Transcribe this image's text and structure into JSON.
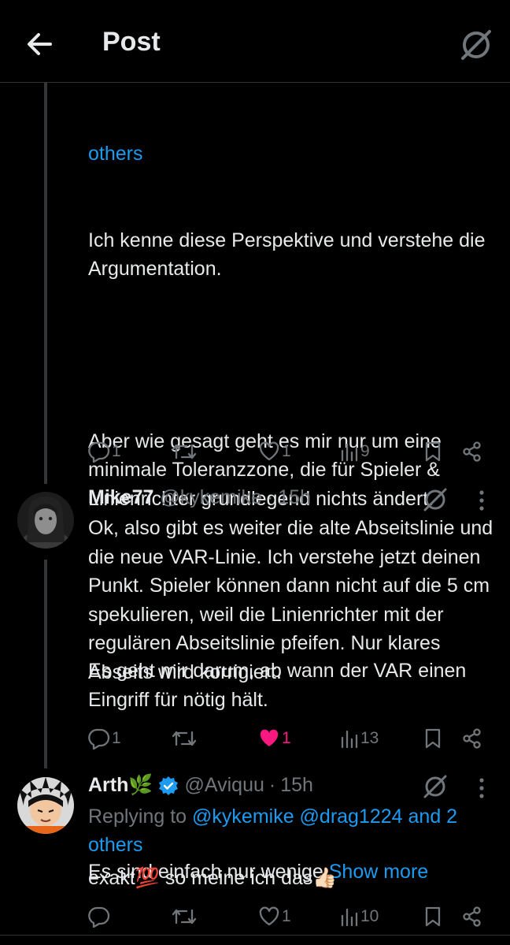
{
  "header": {
    "title": "Post",
    "back_icon": "arrow-left-icon",
    "grok_icon": "grok-icon"
  },
  "post1": {
    "continued_link": "others",
    "body_1": "Ich kenne diese Perspektive und verstehe die Argumentation.",
    "body_2": "Aber wie gesagt geht es mir nur um eine minimale Toleranzzone, die für Spieler & Linienrichter grundlegend nichts ändert.",
    "body_3": "Es geht mir darum, ab wann der VAR einen Eingriff für nötig hält.",
    "body_4": "Es sind einfach nur wenige ",
    "show_more": "Show more",
    "replies": "1",
    "likes": "1",
    "views": "9"
  },
  "post2": {
    "name": "Mike77",
    "handle": "@kykemike",
    "separator": "·",
    "time": "15h",
    "body": "Ok, also gibt es weiter die alte Abseitslinie und die neue VAR-Linie. Ich verstehe jetzt deinen Punkt. Spieler können dann nicht auf die 5 cm spekulieren, weil die Linienrichter mit der regulären Abseitslinie pfeifen. Nur klares Abseits wird korrigiert.",
    "replies": "1",
    "likes": "1",
    "views": "13",
    "liked_color": "#f91880"
  },
  "post3": {
    "name": "Arth🌿",
    "handle": "@Aviquu",
    "separator": "·",
    "time": "15h",
    "replying_prefix": "Replying to ",
    "replying_users": "@kykemike @drag1224 and 2",
    "replying_others": "others",
    "body": "exakt💯 so meine ich das👍🏻",
    "likes": "1",
    "views": "10"
  },
  "colors": {
    "accent": "#1d9bf0",
    "muted": "#71767b",
    "verified": "#1d9bf0"
  }
}
